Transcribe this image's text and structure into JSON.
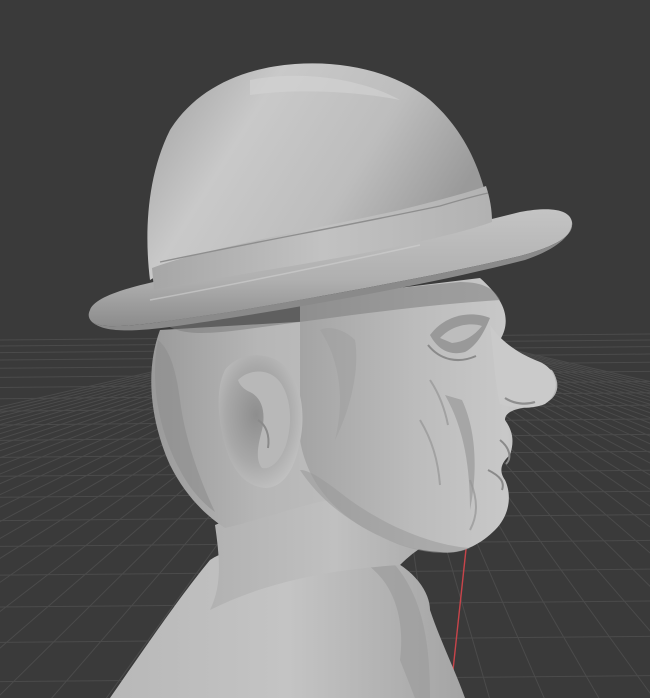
{
  "app": {
    "type": "3d-viewport",
    "mode": "sculpt"
  },
  "colors": {
    "background": "#3a3a3a",
    "grid_line": "#4b4b4b",
    "axis_y": "#c8444a",
    "model_light": "#c6c6c6",
    "model_mid": "#a8a8a8",
    "model_shadow": "#8a8a8a",
    "model_dark": "#6c6c6c"
  },
  "viewport": {
    "floor_grid": "visible",
    "axis_line": "y-axis-red",
    "model_name": "",
    "model_description_icon": "bust-with-bowler-hat"
  }
}
